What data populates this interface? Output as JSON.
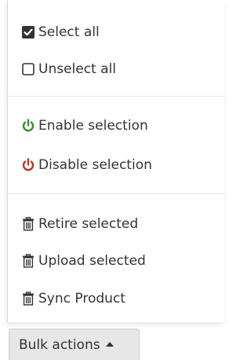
{
  "menu": {
    "items": [
      {
        "label": "Select all",
        "icon": "checkbox-checked-icon"
      },
      {
        "label": "Unselect all",
        "icon": "checkbox-empty-icon"
      },
      {
        "label": "Enable selection",
        "icon": "power-icon",
        "icon_color": "#3c8d2f"
      },
      {
        "label": "Disable selection",
        "icon": "power-icon",
        "icon_color": "#b8322b"
      },
      {
        "label": "Retire selected",
        "icon": "trash-icon"
      },
      {
        "label": "Upload selected",
        "icon": "trash-icon"
      },
      {
        "label": "Sync Product",
        "icon": "trash-icon"
      }
    ]
  },
  "toolbar": {
    "bulk_actions_label": "Bulk actions"
  }
}
